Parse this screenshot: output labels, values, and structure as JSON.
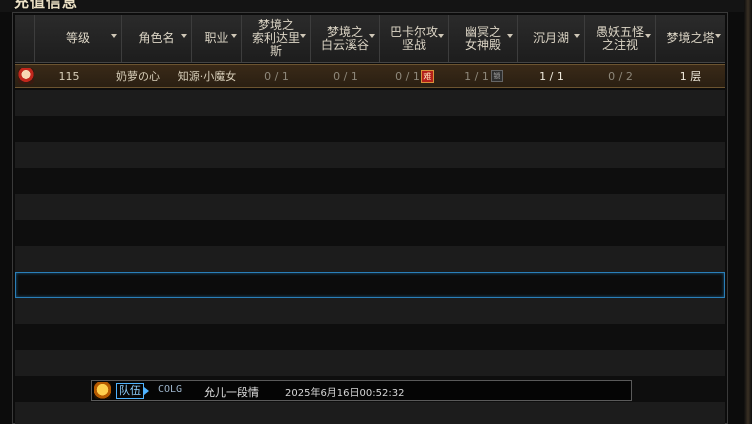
{
  "window": {
    "title": "充值信息"
  },
  "table": {
    "columns": [
      {
        "label": "等级"
      },
      {
        "label": "角色名"
      },
      {
        "label": "职业"
      },
      {
        "label": "梦境之\n索利达里\n斯"
      },
      {
        "label": "梦境之\n白云溪谷"
      },
      {
        "label": "巴卡尔攻\n坚战"
      },
      {
        "label": "幽冥之\n女神殿"
      },
      {
        "label": "沉月湖"
      },
      {
        "label": "愚妖五怪\n之注视"
      },
      {
        "label": "梦境之塔"
      }
    ],
    "rows": [
      {
        "level": "115",
        "name": "奶萝の心",
        "job": "知源·小魔女",
        "soli": "0 / 1",
        "baiyun": "0 / 1",
        "bakal": "0 / 1",
        "bakal_tag": "难",
        "youming": "1 / 1",
        "youming_tag": "锁",
        "chenyue": "1 / 1",
        "yuyao": "0 / 2",
        "tower": "1 层"
      }
    ]
  },
  "chat": {
    "icon": "chat-emote-icon",
    "channel": "队伍",
    "sender": "COLG",
    "message": "允儿一段情",
    "timestamp": "2025年6月16日00:52:32"
  },
  "colors": {
    "accent_blue": "#2a7fb8",
    "row_highlight": "#3a2a18",
    "hard_tag": "#b3201a"
  }
}
